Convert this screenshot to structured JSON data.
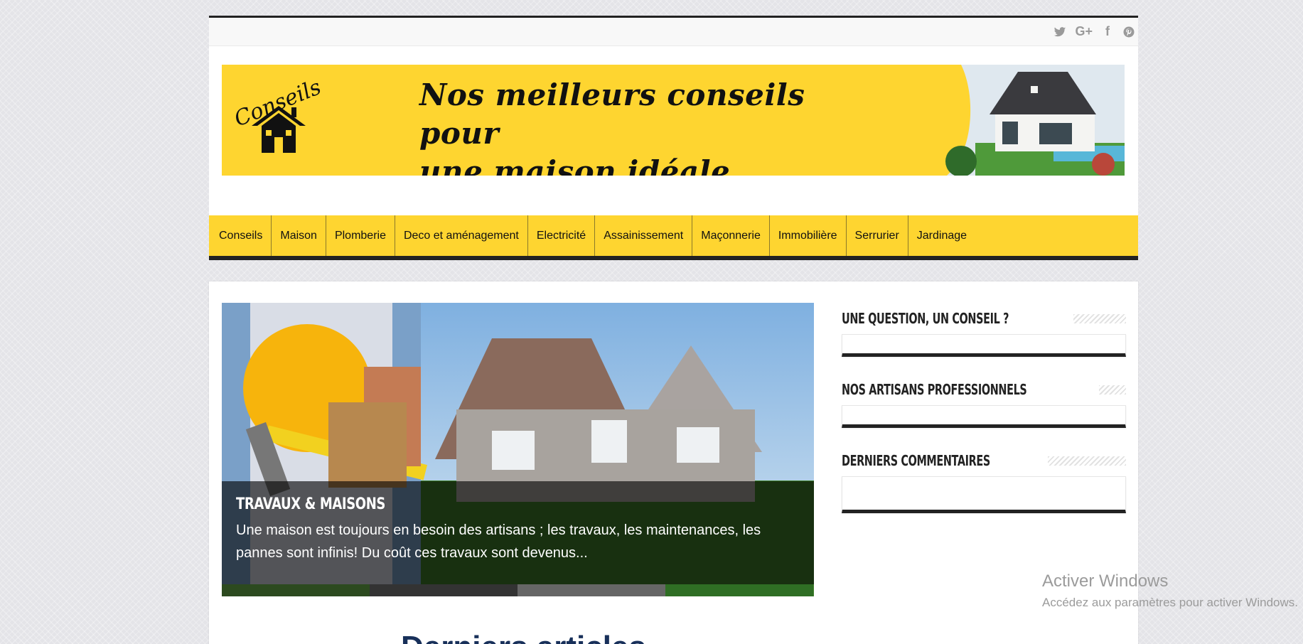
{
  "header": {
    "social_icons": [
      "twitter-icon",
      "google-plus-icon",
      "facebook-icon",
      "pinterest-icon"
    ],
    "social_labels": [
      "t",
      "G+",
      "f",
      "p"
    ],
    "banner": {
      "logo_text": "Conseils",
      "headline": "Nos meilleurs conseils pour\n une maison idéale..."
    }
  },
  "nav": {
    "items": [
      "Conseils",
      "Maison",
      "Plomberie",
      "Deco et aménagement",
      "Electricité",
      "Assainissement",
      "Maçonnerie",
      "Immobilière",
      "Serrurier",
      "Jardinage"
    ]
  },
  "slider": {
    "title": "TRAVAUX & MAISONS",
    "excerpt": "Une maison est toujours en besoin des artisans ; les travaux, les maintenances, les pannes  sont infinis! Du coût ces travaux sont devenus..."
  },
  "sidebar": {
    "widgets": [
      {
        "title": "UNE QUESTION, UN CONSEIL ?"
      },
      {
        "title": "NOS ARTISANS PROFESSIONNELS"
      },
      {
        "title": "DERNIERS COMMENTAIRES"
      }
    ]
  },
  "main": {
    "section_heading": "Derniers articles"
  },
  "os_overlay": {
    "title": "Activer Windows",
    "subtitle": "Accédez aux paramètres pour activer Windows."
  },
  "colors": {
    "brand_yellow": "#fed530",
    "dark": "#222222",
    "heading_blue": "#18305a"
  }
}
